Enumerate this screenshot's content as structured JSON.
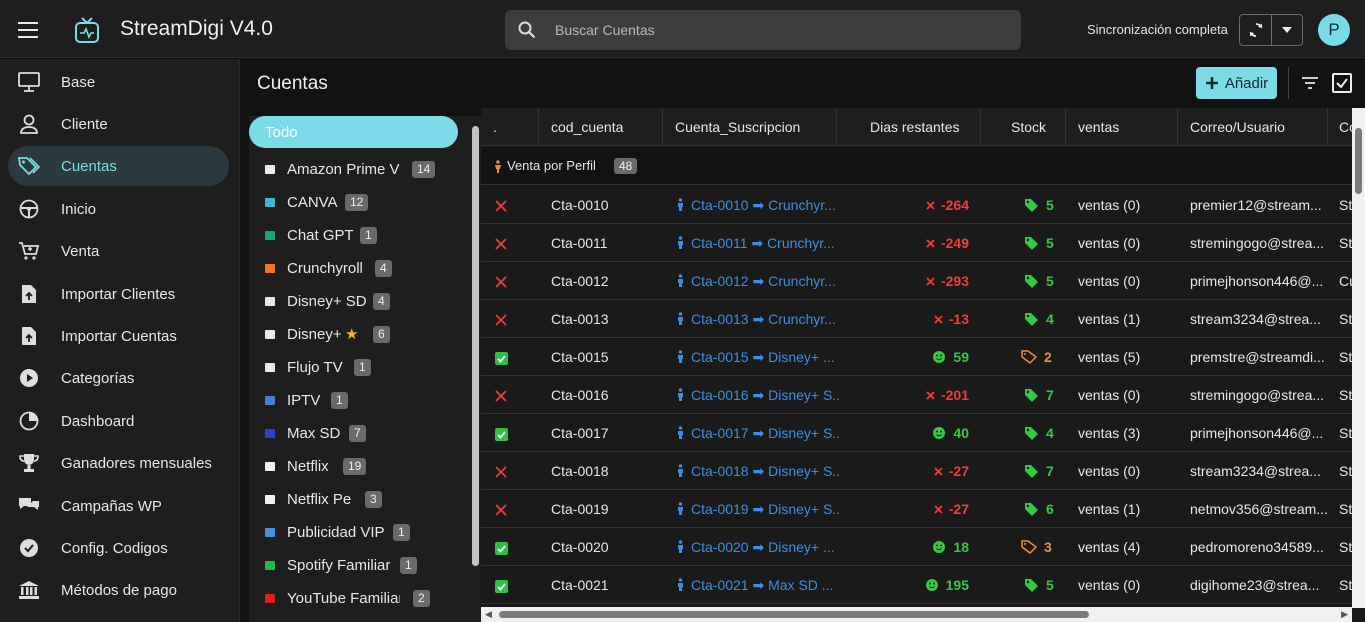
{
  "app": {
    "title": "StreamDigi V4.0"
  },
  "search": {
    "placeholder": "Buscar Cuentas"
  },
  "sync": {
    "status": "Sincronización completa"
  },
  "user": {
    "initial": "P"
  },
  "sidebar": {
    "items": [
      {
        "label": "Base",
        "icon": "monitor-icon"
      },
      {
        "label": "Cliente",
        "icon": "user-icon"
      },
      {
        "label": "Cuentas",
        "icon": "tags-icon",
        "active": true
      },
      {
        "label": "Inicio",
        "icon": "steering-wheel-icon"
      },
      {
        "label": "Venta",
        "icon": "cart-icon"
      },
      {
        "label": "Importar Clientes",
        "icon": "file-upload-icon"
      },
      {
        "label": "Importar Cuentas",
        "icon": "file-upload-icon"
      },
      {
        "label": "Categorías",
        "icon": "play-circle-icon"
      },
      {
        "label": "Dashboard",
        "icon": "pie-chart-icon"
      },
      {
        "label": "Ganadores mensuales",
        "icon": "trophy-icon"
      },
      {
        "label": "Campañas WP",
        "icon": "chat-bubbles-icon"
      },
      {
        "label": "Config. Codigos",
        "icon": "badge-check-icon"
      },
      {
        "label": "Métodos de pago",
        "icon": "bank-icon"
      }
    ]
  },
  "main": {
    "title": "Cuentas",
    "add_label": "Añadir"
  },
  "categories": {
    "all_label": "Todo",
    "items": [
      {
        "label": "Amazon Prime Vi",
        "count": "14",
        "color": "#ececec"
      },
      {
        "label": "CANVA",
        "count": "12",
        "color": "#3fb5d8"
      },
      {
        "label": "Chat GPT",
        "count": "1",
        "color": "#14a37f"
      },
      {
        "label": "Crunchyroll",
        "count": "4",
        "color": "#f47521"
      },
      {
        "label": "Disney+ SD",
        "count": "4",
        "color": "#e8e8e8"
      },
      {
        "label": "Disney+",
        "count": "6",
        "color": "#e8e8e8",
        "star": "★"
      },
      {
        "label": "Flujo TV",
        "count": "1",
        "color": "#f2e6d8"
      },
      {
        "label": "IPTV",
        "count": "1",
        "color": "#4a7fd0"
      },
      {
        "label": "Max SD",
        "count": "7",
        "color": "#2a3fd6"
      },
      {
        "label": "Netflix",
        "count": "19",
        "color": "#f0f0f0"
      },
      {
        "label": "Netflix Pe",
        "count": "3",
        "color": "#f0f0f0"
      },
      {
        "label": "Publicidad VIP",
        "count": "1",
        "color": "#4a90d9"
      },
      {
        "label": "Spotify Familiar",
        "count": "1",
        "color": "#1db954"
      },
      {
        "label": "YouTube Familiar",
        "count": "2",
        "color": "#e02020"
      }
    ]
  },
  "table": {
    "columns": [
      ".",
      "cod_cuenta",
      "Cuenta_Suscripcion",
      "Dias restantes",
      "Stock",
      "ventas",
      "Correo/Usuario",
      "Co"
    ],
    "group": {
      "label": "Venta por Perfil",
      "count": "48"
    },
    "rows": [
      {
        "status": "x",
        "cod": "Cta-0010",
        "cuenta": "Cta-0010 ➡ Crunchyr...",
        "dias": "-264",
        "stock": "5",
        "stock_tag": "green",
        "ventas": "ventas (0)",
        "correo": "premier12@stream...",
        "extra": "St"
      },
      {
        "status": "x",
        "cod": "Cta-0011",
        "cuenta": "Cta-0011 ➡ Crunchyr...",
        "dias": "-249",
        "stock": "5",
        "stock_tag": "green",
        "ventas": "ventas (0)",
        "correo": "stremingogo@strea...",
        "extra": "St"
      },
      {
        "status": "x",
        "cod": "Cta-0012",
        "cuenta": "Cta-0012 ➡ Crunchyr...",
        "dias": "-293",
        "stock": "5",
        "stock_tag": "green",
        "ventas": "ventas (0)",
        "correo": "primejhonson446@...",
        "extra": "Cu"
      },
      {
        "status": "x",
        "cod": "Cta-0013",
        "cuenta": "Cta-0013 ➡ Crunchyr...",
        "dias": "-13",
        "stock": "4",
        "stock_tag": "green",
        "ventas": "ventas (1)",
        "correo": "stream3234@strea...",
        "extra": "St"
      },
      {
        "status": "ok",
        "cod": "Cta-0015",
        "cuenta": "Cta-0015 ➡ Disney+ ...",
        "dias": "59",
        "stock": "2",
        "stock_tag": "orange",
        "ventas": "ventas (5)",
        "correo": "premstre@streamdi...",
        "extra": "St"
      },
      {
        "status": "x",
        "cod": "Cta-0016",
        "cuenta": "Cta-0016 ➡ Disney+ S...",
        "dias": "-201",
        "stock": "7",
        "stock_tag": "green",
        "ventas": "ventas (0)",
        "correo": "stremingogo@strea...",
        "extra": "St"
      },
      {
        "status": "ok",
        "cod": "Cta-0017",
        "cuenta": "Cta-0017 ➡ Disney+ S...",
        "dias": "40",
        "stock": "4",
        "stock_tag": "green",
        "ventas": "ventas (3)",
        "correo": "primejhonson446@...",
        "extra": "St"
      },
      {
        "status": "x",
        "cod": "Cta-0018",
        "cuenta": "Cta-0018 ➡ Disney+ S...",
        "dias": "-27",
        "stock": "7",
        "stock_tag": "green",
        "ventas": "ventas (0)",
        "correo": "stream3234@strea...",
        "extra": "St"
      },
      {
        "status": "x",
        "cod": "Cta-0019",
        "cuenta": "Cta-0019 ➡ Disney+ S...",
        "dias": "-27",
        "stock": "6",
        "stock_tag": "green",
        "ventas": "ventas (1)",
        "correo": "netmov356@stream...",
        "extra": "St"
      },
      {
        "status": "ok",
        "cod": "Cta-0020",
        "cuenta": "Cta-0020 ➡ Disney+ ...",
        "dias": "18",
        "stock": "3",
        "stock_tag": "orange",
        "ventas": "ventas (4)",
        "correo": "pedromoreno34589...",
        "extra": "St"
      },
      {
        "status": "ok",
        "cod": "Cta-0021",
        "cuenta": "Cta-0021 ➡ Max SD ...",
        "dias": "195",
        "stock": "5",
        "stock_tag": "green",
        "ventas": "ventas (0)",
        "correo": "digihome23@strea...",
        "extra": "St"
      }
    ]
  },
  "colors": {
    "accent": "#7ddbe9",
    "danger": "#f03c3c",
    "success": "#35c845",
    "warning": "#e6923a",
    "link": "#3d8ee3"
  }
}
